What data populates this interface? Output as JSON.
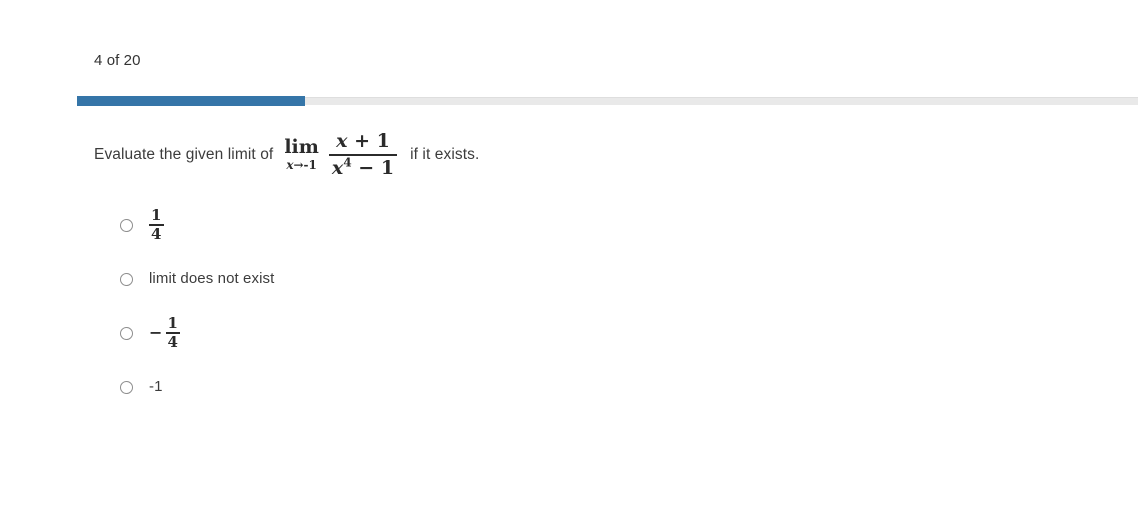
{
  "progress": {
    "counter_label": "4 of 20",
    "current": 4,
    "total": 20,
    "percent": 21.5,
    "fill_color": "#3575a8",
    "track_color": "#e9e9e9"
  },
  "question": {
    "lead_text": "Evaluate the given limit of",
    "trailing_text": "if it exists.",
    "expression": {
      "limit_word": "lim",
      "limit_sub_variable": "x",
      "limit_sub_arrow": "→",
      "limit_sub_target": "-1",
      "numerator_var": "x",
      "numerator_rest": "+ 1",
      "denominator_var": "x",
      "denominator_exponent": "4",
      "denominator_rest": "− 1"
    }
  },
  "options": [
    {
      "id": "option-a",
      "kind": "fraction",
      "numerator": "1",
      "denominator": "4",
      "sign": "",
      "selected": false
    },
    {
      "id": "option-b",
      "kind": "text",
      "label": "limit does not exist",
      "selected": false
    },
    {
      "id": "option-c",
      "kind": "fraction",
      "numerator": "1",
      "denominator": "4",
      "sign": "−",
      "selected": false
    },
    {
      "id": "option-d",
      "kind": "text",
      "label": "-1",
      "selected": false
    }
  ]
}
